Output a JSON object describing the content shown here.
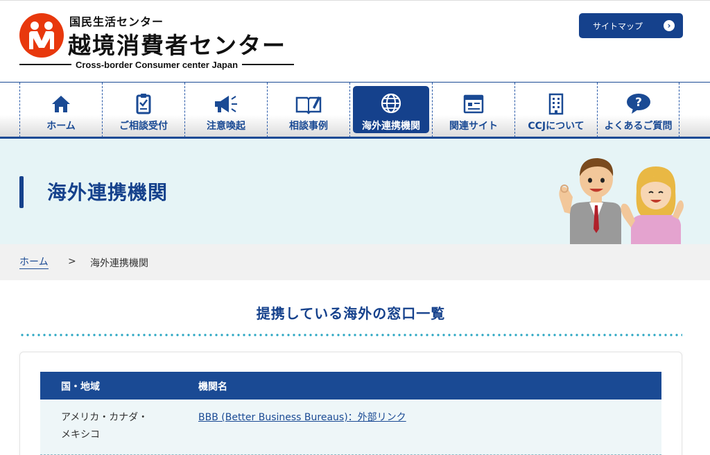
{
  "header": {
    "logo_sub": "国民生活センター",
    "logo_main": "越境消費者センター",
    "logo_en": "Cross-border Consumer center Japan",
    "sitemap_label": "サイトマップ"
  },
  "nav": {
    "items": [
      {
        "label": "ホーム",
        "icon": "home-icon"
      },
      {
        "label": "ご相談受付",
        "icon": "clipboard-icon"
      },
      {
        "label": "注意喚起",
        "icon": "megaphone-icon"
      },
      {
        "label": "相談事例",
        "icon": "book-icon"
      },
      {
        "label": "海外連携機関",
        "icon": "globe-icon",
        "active": true
      },
      {
        "label": "関連サイト",
        "icon": "browser-icon"
      },
      {
        "label": "CCJについて",
        "icon": "building-icon"
      },
      {
        "label": "よくあるご質問",
        "icon": "question-icon"
      }
    ],
    "accent": "#15418c"
  },
  "hero": {
    "title": "海外連携機関"
  },
  "breadcrumb": {
    "home": "ホーム",
    "separator": ">",
    "current": "海外連携機関"
  },
  "section": {
    "title": "提携している海外の窓口一覧"
  },
  "table": {
    "headers": [
      "国・地域",
      "機関名"
    ],
    "rows": [
      {
        "region": "アメリカ・カナダ・メキシコ",
        "agency": "BBB (Better Business Bureaus)：外部リンク"
      }
    ]
  }
}
